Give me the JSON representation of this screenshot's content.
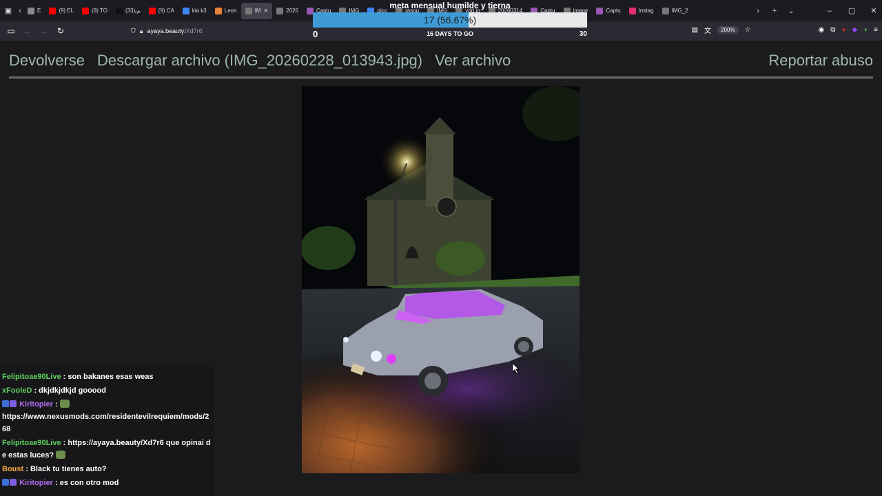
{
  "browser": {
    "tabs": [
      {
        "label": "E",
        "color": "#8a8a8a"
      },
      {
        "label": "(9) EL",
        "color": "#ff0000"
      },
      {
        "label": "(9) TO",
        "color": "#ff0000"
      },
      {
        "label": "ﻢﯾ(33)",
        "color": "#111111"
      },
      {
        "label": "(9) CA",
        "color": "#ff0000"
      },
      {
        "label": "kia k3",
        "color": "#4285f4"
      },
      {
        "label": "Leon",
        "color": "#e8833a"
      },
      {
        "label": "IM",
        "color": "#777777",
        "active": true
      },
      {
        "label": "2026",
        "color": "#777777"
      },
      {
        "label": "Captu",
        "color": "#9b59b6"
      },
      {
        "label": "IMG",
        "color": "#777777"
      },
      {
        "label": "pico",
        "color": "#4285f4"
      },
      {
        "label": "rasqu",
        "color": "#777777"
      },
      {
        "label": "IMG",
        "color": "#777777"
      },
      {
        "label": "ydd.jp",
        "color": "#777777"
      },
      {
        "label": "20260314",
        "color": "#777777"
      },
      {
        "label": "Captu",
        "color": "#9b59b6"
      },
      {
        "label": "image",
        "color": "#777777"
      },
      {
        "label": "Captu",
        "color": "#9b59b6"
      },
      {
        "label": "Instag",
        "color": "#e1306c"
      },
      {
        "label": "IMG_2",
        "color": "#777777"
      }
    ],
    "url_host": "ayaya.beauty",
    "url_path": "/Xd7r6",
    "zoom": "200%"
  },
  "goal": {
    "title": "meta mensual humilde y tierna",
    "value_text": "17 (56.67%)",
    "fraction": 0.5667,
    "min": "0",
    "days": "16 DAYS TO GO",
    "max": "30"
  },
  "page": {
    "back": "Devolverse",
    "download": "Descargar archivo (IMG_20260228_013943.jpg)",
    "view": "Ver archivo",
    "report": "Reportar abuso"
  },
  "chat": [
    {
      "user": "Felipitoae90Live",
      "color": "#5fd35f",
      "text": " : son bakanes esas weas"
    },
    {
      "user": "xFooleD",
      "color": "#5fd35f",
      "text": " : dkjdkjdkjd gooood"
    },
    {
      "user": "Kiritopier",
      "color": "#b26cf0",
      "badges": true,
      "text": " : ",
      "emote": true,
      "line2": "https://www.nexusmods.com/residentevilrequiem/mods/268"
    },
    {
      "user": "Felipitoae90Live",
      "color": "#5fd35f",
      "text": " : https://ayaya.beauty/Xd7r6 que opinai de estas luces? ",
      "emote_end": true
    },
    {
      "user": "Boust",
      "color": "#f0a43c",
      "text": " : Black tu tienes auto?"
    },
    {
      "user": "Kiritopier",
      "color": "#b26cf0",
      "badges": true,
      "text": " : es con otro mod"
    }
  ]
}
